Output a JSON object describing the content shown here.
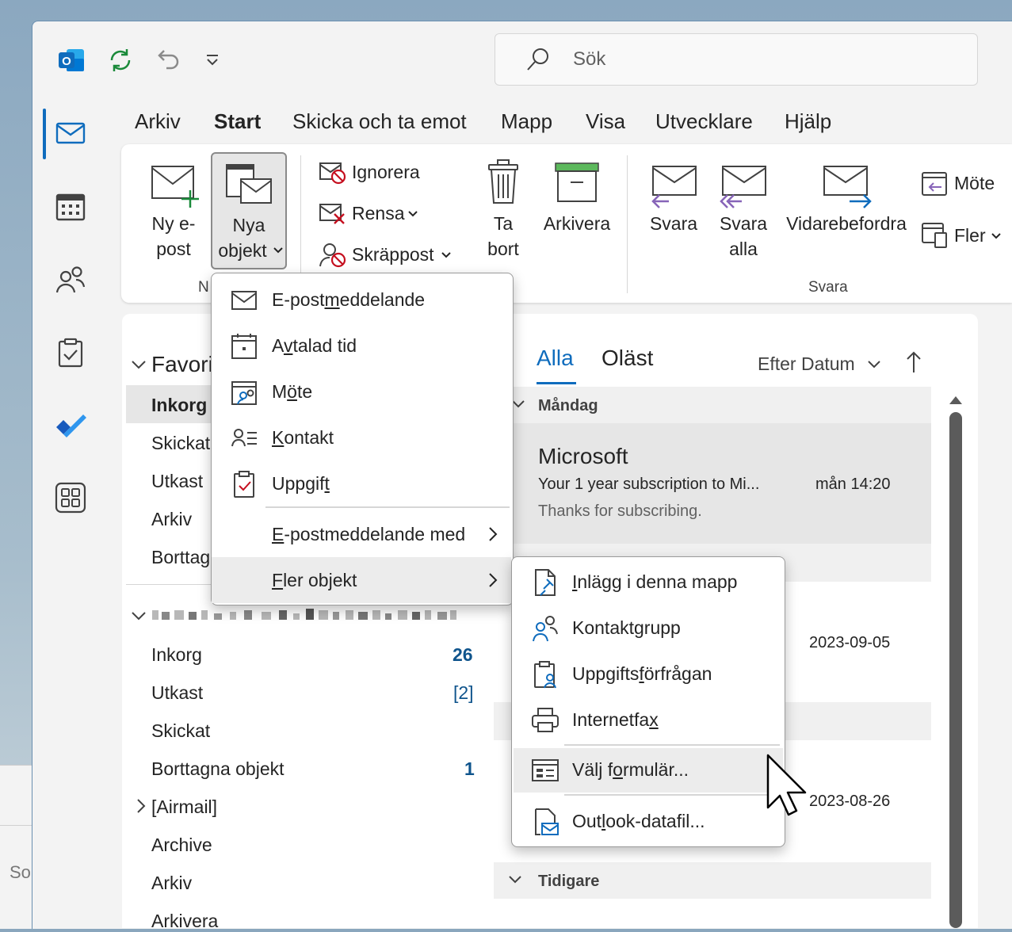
{
  "search": {
    "placeholder": "Sök"
  },
  "menu_tabs": [
    "Arkiv",
    "Start",
    "Skicka och ta emot",
    "Mapp",
    "Visa",
    "Utvecklare",
    "Hjälp"
  ],
  "ribbon": {
    "new_mail": [
      "Ny e-",
      "post"
    ],
    "new_items": [
      "Nya",
      "objekt"
    ],
    "new_group_label": "N",
    "ignore": "Ignorera",
    "clean": "Rensa",
    "junk": "Skräppost",
    "delete": [
      "Ta",
      "bort"
    ],
    "archive": "Arkivera",
    "reply": "Svara",
    "reply_all": [
      "Svara",
      "alla"
    ],
    "forward": "Vidarebefordra",
    "meeting": "Möte",
    "more": "Fler",
    "reply_group_label": "Svara"
  },
  "folders": {
    "favorites_label": "Favori",
    "favorites": [
      "Inkorg",
      "Skickat",
      "Utkast",
      "Arkiv",
      "Borttag"
    ],
    "account": [
      {
        "name": "Inkorg",
        "count": "26"
      },
      {
        "name": "Utkast",
        "count": "[2]"
      },
      {
        "name": "Skickat",
        "count": ""
      },
      {
        "name": "Borttagna objekt",
        "count": "1"
      },
      {
        "name": "[Airmail]",
        "count": ""
      },
      {
        "name": "Archive",
        "count": ""
      },
      {
        "name": "Arkiv",
        "count": ""
      },
      {
        "name": "Arkivera",
        "count": ""
      }
    ]
  },
  "message_list": {
    "tab_all": "Alla",
    "tab_unread": "Oläst",
    "sort": "Efter Datum",
    "group_monday": "Måndag",
    "group_earlier": "Tidigare",
    "msg1": {
      "sender": "Microsoft",
      "subject": "Your 1 year subscription to Mi...",
      "time": "mån 14:20",
      "preview": "Thanks for subscribing."
    },
    "date2": "2023-09-05",
    "date3": "2023-08-26"
  },
  "new_items_menu": [
    {
      "pre": "E-post",
      "u": "m",
      "post": "eddelande",
      "icon": "mail-icon"
    },
    {
      "pre": "A",
      "u": "v",
      "post": "talad tid",
      "icon": "calendar-icon"
    },
    {
      "pre": "M",
      "u": "ö",
      "post": "te",
      "icon": "meeting-icon"
    },
    {
      "pre": "",
      "u": "K",
      "post": "ontakt",
      "icon": "contact-icon"
    },
    {
      "pre": "Uppgif",
      "u": "t",
      "post": "",
      "icon": "task-icon"
    },
    {
      "pre": "",
      "u": "E",
      "post": "-postmeddelande med",
      "icon": ""
    },
    {
      "pre": "",
      "u": "F",
      "post": "ler objekt",
      "icon": ""
    }
  ],
  "more_items_menu": [
    {
      "pre": "",
      "u": "I",
      "post": "nlägg i denna mapp",
      "icon": "post-icon"
    },
    {
      "pre": "Kontakt",
      "u": "g",
      "post": "rupp",
      "icon": "contact-group-icon"
    },
    {
      "pre": "Uppgifts",
      "u": "f",
      "post": "örfrågan",
      "icon": "task-request-icon"
    },
    {
      "pre": "Internetfa",
      "u": "x",
      "post": "",
      "icon": "fax-icon"
    },
    {
      "pre": "Välj f",
      "u": "o",
      "post": "rmulär...",
      "icon": "form-icon"
    },
    {
      "pre": "Out",
      "u": "l",
      "post": "ook-datafil...",
      "icon": "data-file-icon"
    }
  ]
}
